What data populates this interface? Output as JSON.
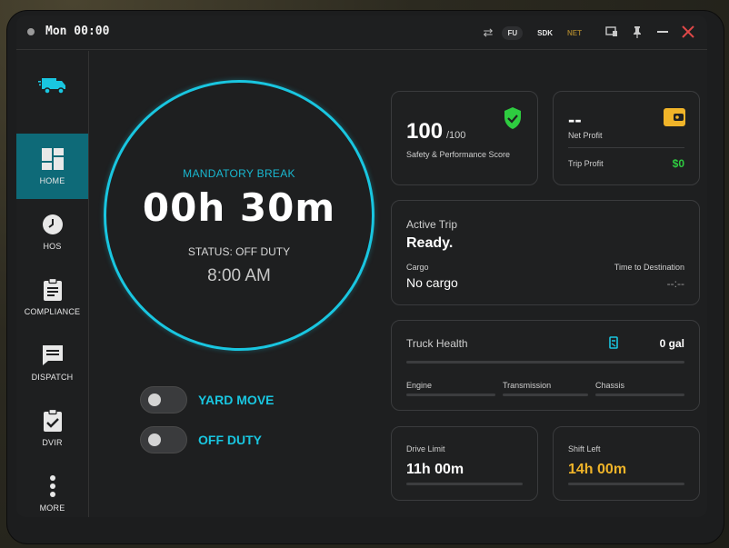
{
  "titlebar": {
    "clock": "Mon 00:00",
    "status_pills": [
      "FU",
      "SDK",
      "NET"
    ]
  },
  "sidebar": {
    "items": [
      {
        "label": "HOME",
        "icon": "dashboard-icon",
        "active": true
      },
      {
        "label": "HOS",
        "icon": "clock-icon",
        "active": false
      },
      {
        "label": "COMPLIANCE",
        "icon": "clipboard-icon",
        "active": false
      },
      {
        "label": "DISPATCH",
        "icon": "message-icon",
        "active": false
      },
      {
        "label": "DVIR",
        "icon": "checklist-icon",
        "active": false
      },
      {
        "label": "MORE",
        "icon": "more-vertical-icon",
        "active": false
      }
    ]
  },
  "timer": {
    "title": "MANDATORY BREAK",
    "time": "00h 30m",
    "status": "STATUS: OFF DUTY",
    "clock": "8:00 AM"
  },
  "toggles": [
    {
      "label": "YARD MOVE",
      "on": false
    },
    {
      "label": "OFF DUTY",
      "on": false
    }
  ],
  "safety": {
    "score": "100",
    "max": "/100",
    "label": "Safety & Performance Score"
  },
  "profit": {
    "value": "--",
    "label": "Net Profit",
    "trip_label": "Trip Profit",
    "trip_value": "$0"
  },
  "trip": {
    "label": "Active Trip",
    "status": "Ready.",
    "cargo_label": "Cargo",
    "cargo_value": "No cargo",
    "eta_label": "Time to Destination",
    "eta_value": "--:--"
  },
  "health": {
    "label": "Truck Health",
    "fuel": "0 gal",
    "parts": [
      "Engine",
      "Transmission",
      "Chassis"
    ]
  },
  "drive": {
    "label": "Drive Limit",
    "value": "11h 00m"
  },
  "shift": {
    "label": "Shift Left",
    "value": "14h 00m"
  },
  "colors": {
    "accent": "#19c6e0",
    "active_nav": "#0e6a78",
    "success": "#2ecc40",
    "warning": "#f0b429",
    "close": "#e04848"
  }
}
